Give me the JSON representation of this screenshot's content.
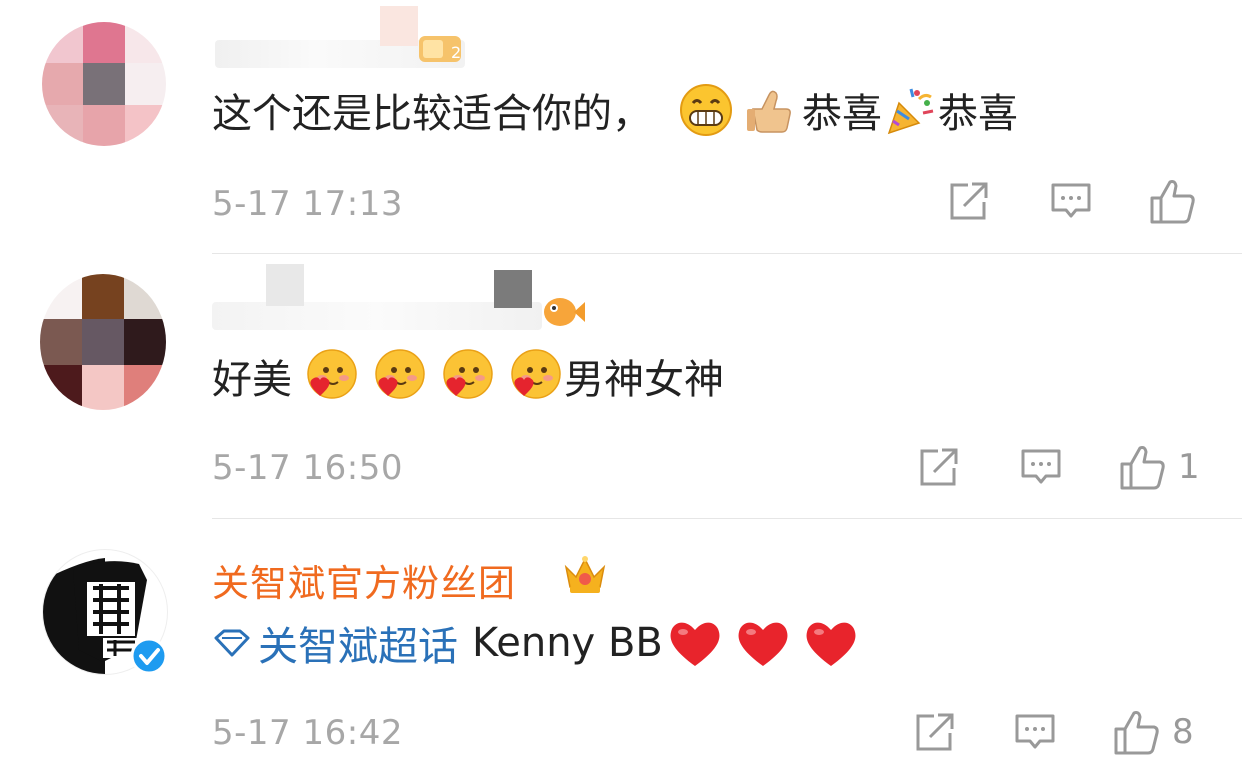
{
  "comments": [
    {
      "body_text": "这个还是比较适合你的，",
      "body_tail_1": "恭喜",
      "body_tail_2": "恭喜",
      "emojis": [
        "grinning-emoji",
        "thumbs-up-emoji",
        "party-popper-emoji"
      ],
      "time": "5-17 17:13",
      "like_count": ""
    },
    {
      "body_text": "好美",
      "body_tail": "男神女神",
      "emojis": [
        "heart-kiss-emoji",
        "heart-kiss-emoji",
        "heart-kiss-emoji",
        "heart-kiss-emoji"
      ],
      "time": "5-17 16:50",
      "like_count": "1"
    },
    {
      "username": "关智斌官方粉丝团",
      "topic": "关智斌超话",
      "body_text": "Kenny BB",
      "emojis": [
        "red-heart-emoji",
        "red-heart-emoji",
        "red-heart-emoji"
      ],
      "time": "5-17 16:42",
      "like_count": "8",
      "verified": true
    }
  ],
  "colors": {
    "fan_name": "#f06a1f",
    "topic": "#2a71b8",
    "meta": "#a7a7a7",
    "text": "#222222"
  }
}
